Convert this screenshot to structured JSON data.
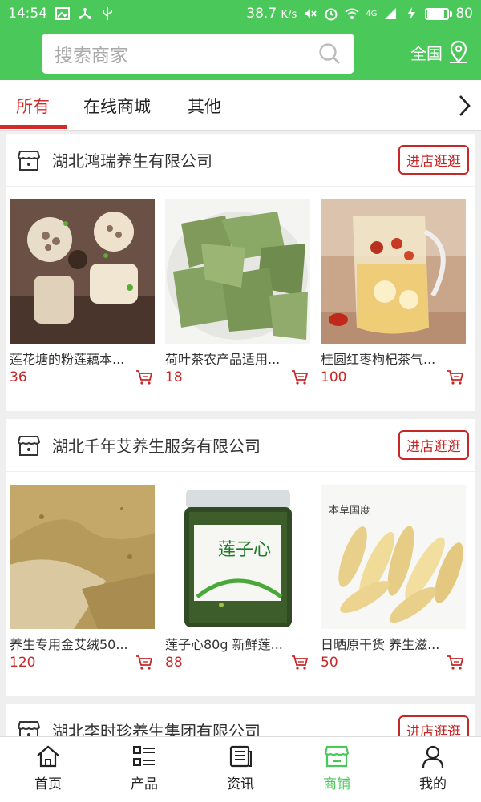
{
  "status_bar": {
    "time": "14:54",
    "net_speed": "38.7",
    "net_unit": "K/s",
    "network": "4G",
    "battery": "80"
  },
  "header": {
    "search_placeholder": "搜索商家",
    "region": "全国"
  },
  "tabs": [
    "所有",
    "在线商城",
    "其他"
  ],
  "active_tab": 0,
  "shops": [
    {
      "name": "湖北鸿瑞养生有限公司",
      "enter_label": "进店逛逛",
      "products": [
        {
          "name": "莲花塘的粉莲藕本...",
          "price": "36"
        },
        {
          "name": "荷叶茶农产品适用...",
          "price": "18"
        },
        {
          "name": "桂圆红枣枸杞茶气...",
          "price": "100"
        }
      ]
    },
    {
      "name": "湖北千年艾养生服务有限公司",
      "enter_label": "进店逛逛",
      "products": [
        {
          "name": "养生专用金艾绒50...",
          "price": "120",
          "img_text": ""
        },
        {
          "name": "莲子心80g 新鲜莲...",
          "price": "88",
          "img_text": "莲子心"
        },
        {
          "name": "日晒原干货 养生滋...",
          "price": "50",
          "img_text": "本草国度"
        }
      ]
    },
    {
      "name": "湖北李时珍养生集团有限公司",
      "enter_label": "进店逛逛",
      "products": []
    }
  ],
  "bottom_nav": [
    {
      "label": "首页",
      "icon": "home-icon"
    },
    {
      "label": "产品",
      "icon": "grid-list-icon"
    },
    {
      "label": "资讯",
      "icon": "news-icon"
    },
    {
      "label": "商铺",
      "icon": "store-icon"
    },
    {
      "label": "我的",
      "icon": "person-icon"
    }
  ],
  "active_nav": 3,
  "colors": {
    "brand_green": "#4bc85a",
    "accent_red": "#d42a2a",
    "price_red": "#c62828"
  }
}
